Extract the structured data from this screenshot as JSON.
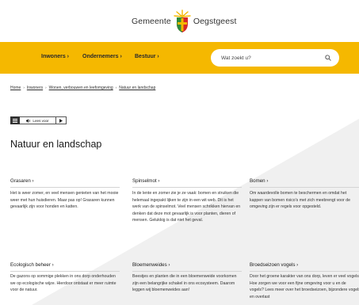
{
  "header": {
    "logo_left": "Gemeente",
    "logo_right": "Oegstgeest"
  },
  "nav": {
    "items": [
      {
        "label": "Inwoners ›"
      },
      {
        "label": "Ondernemers ›"
      },
      {
        "label": "Bestuur ›"
      }
    ],
    "search_placeholder": "Wat zoekt u?"
  },
  "breadcrumb": {
    "items": [
      "Home",
      "Inwoners",
      "Wonen, verbouwen en leefomgeving",
      "Natuur en landschap"
    ],
    "separator": "›"
  },
  "readspeaker": {
    "read_label": "Lees voor"
  },
  "page": {
    "title": "Natuur en landschap"
  },
  "cards": [
    {
      "title": "Grasaren ›",
      "text": "Het is weer zomer, en veel mensen genieten van het mooie weer met hun huisdieren. Maar pas op! Grasaren kunnen gevaarlijk zijn voor honden en katten."
    },
    {
      "title": "Spinselmot ›",
      "text": "In de lente en zomer zie je ze vaak: bomen en struiken die helemaal ingepakt lijken te zijn in een wit web. Dit is het werk van de spinselmot. Veel mensen schrikken hiervan en denken dat deze mot gevaarlijk is voor planten, dieren of mensen. Gelukkig is dat niet het geval."
    },
    {
      "title": "Bomen ›",
      "text": "Om waardevolle bomen te beschermen en omdat het kappen van bomen risico's met zich meebrengt voor de omgeving zijn er regels voor opgesteld."
    },
    {
      "title": "Ecologisch beheer ›",
      "text": "De gazons op sommige plekken in ons dorp onderhouden we op ecologische wijze. Hierdoor ontstaat er meer ruimte voor de natuur."
    },
    {
      "title": "Bloemenweides ›",
      "text": "Beestjes en planten die in een bloemenweide voorkomen zijn een belangrijke schakel in ons ecosysteem. Daarom leggen wij bloemenweides aan!"
    },
    {
      "title": "Broedseizoen vogels ›",
      "text": "Door het groene karakter van ons dorp, leven er veel vogels. Hoe zorgen we voor een fijne omgeving voor u en de vogels? Lees meer over het broedseizoen, bijzondere vogels en overlast"
    }
  ],
  "colors": {
    "nav_yellow": "#f5b800",
    "background": "#f0f0f0"
  }
}
